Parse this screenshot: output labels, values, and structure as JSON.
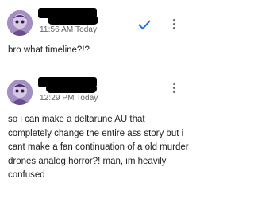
{
  "comments": [
    {
      "timestamp": "11:56 AM Today",
      "text": "bro what timeline?!?",
      "icons": {
        "avatar": "user-avatar",
        "status": "check-icon",
        "menu": "more-vert-icon"
      },
      "colors": {
        "check": "#1a73e8"
      }
    },
    {
      "timestamp": "12:29 PM Today",
      "text": "so i can make a deltarune AU that completely change the entire ass story but i cant make a fan continuation of a old murder drones analog horror?! man, im heavily confused",
      "icons": {
        "avatar": "user-avatar",
        "menu": "more-vert-icon"
      }
    }
  ]
}
